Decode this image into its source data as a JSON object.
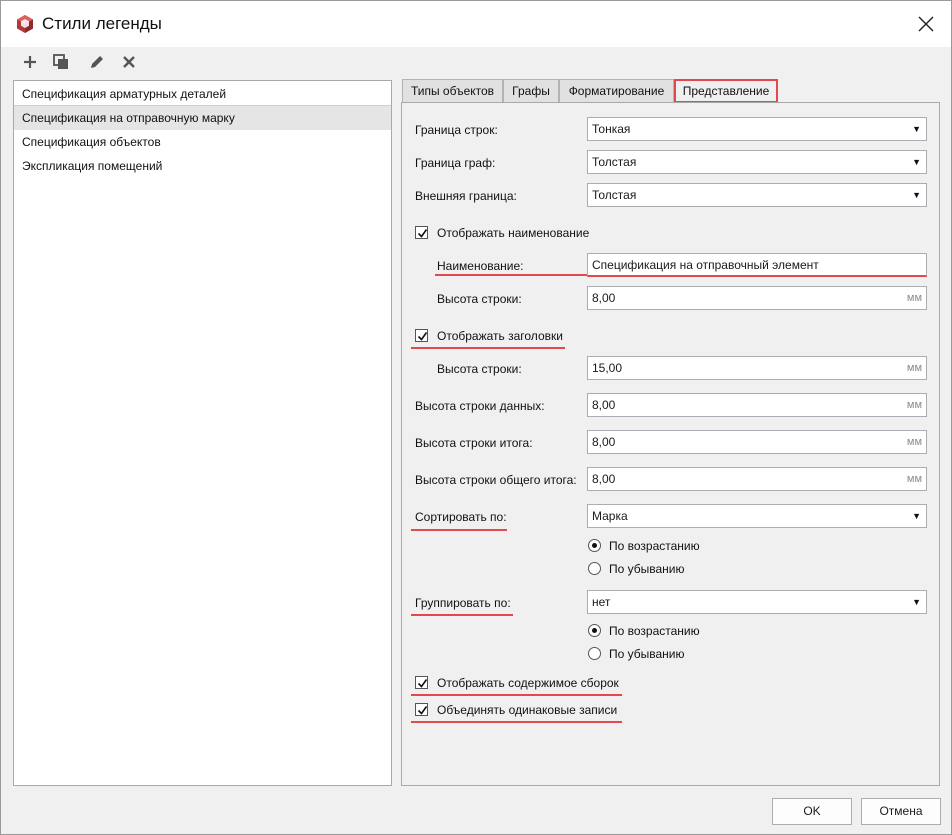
{
  "window": {
    "title": "Стили легенды"
  },
  "toolbar": {
    "icons": [
      "plus-icon",
      "copy-icon",
      "pencil-icon",
      "delete-icon"
    ]
  },
  "list": {
    "items": [
      "Спецификация арматурных деталей",
      "Спецификация на отправочную марку",
      "Спецификация объектов",
      "Экспликация помещений"
    ]
  },
  "tabs": [
    "Типы объектов",
    "Графы",
    "Форматирование",
    "Представление"
  ],
  "form": {
    "row_border_label": "Граница строк:",
    "row_border_value": "Тонкая",
    "col_border_label": "Граница граф:",
    "col_border_value": "Толстая",
    "outer_border_label": "Внешняя граница:",
    "outer_border_value": "Толстая",
    "show_name_label": "Отображать наименование",
    "name_label": "Наименование:",
    "name_value": "Спецификация на отправочный элемент",
    "name_row_height_label": "Высота строки:",
    "name_row_height_value": "8,00",
    "show_headers_label": "Отображать заголовки",
    "header_row_height_label": "Высота строки:",
    "header_row_height_value": "15,00",
    "data_row_height_label": "Высота строки данных:",
    "data_row_height_value": "8,00",
    "total_row_height_label": "Высота строки итога:",
    "total_row_height_value": "8,00",
    "grand_total_row_height_label": "Высота строки общего итога:",
    "grand_total_row_height_value": "8,00",
    "unit": "мм",
    "sort_by_label": "Сортировать по:",
    "sort_by_value": "Марка",
    "sort_asc_label": "По возрастанию",
    "sort_desc_label": "По убыванию",
    "group_by_label": "Группировать по:",
    "group_by_value": "нет",
    "group_asc_label": "По возрастанию",
    "group_desc_label": "По убыванию",
    "show_assembly_label": "Отображать содержимое сборок",
    "merge_records_label": "Объединять одинаковые записи"
  },
  "buttons": {
    "ok": "OK",
    "cancel": "Отмена"
  },
  "colors": {
    "accent": "#e0494e"
  }
}
